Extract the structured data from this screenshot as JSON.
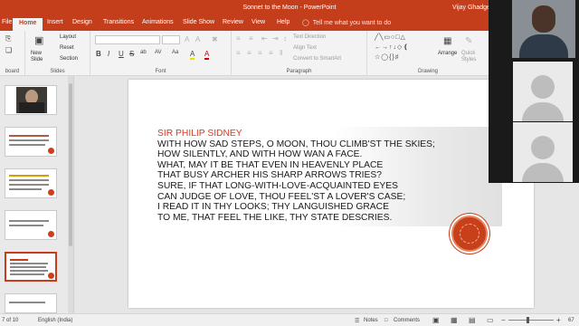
{
  "window": {
    "doc_title": "Sonnet to the Moon  -  PowerPoint",
    "user_name": "Vijay Ghadge"
  },
  "tabs": [
    {
      "label": "File"
    },
    {
      "label": "Home"
    },
    {
      "label": "Insert"
    },
    {
      "label": "Design"
    },
    {
      "label": "Transitions"
    },
    {
      "label": "Animations"
    },
    {
      "label": "Slide Show"
    },
    {
      "label": "Review"
    },
    {
      "label": "View"
    },
    {
      "label": "Help"
    }
  ],
  "tell_me": "Tell me what you want to do",
  "ribbon": {
    "groups": {
      "clipboard": "board",
      "slides": "Slides",
      "font": "Font",
      "paragraph": "Paragraph",
      "drawing": "Drawing"
    },
    "slides": {
      "new_slide": "New Slide",
      "layout": "Layout",
      "reset": "Reset",
      "section": "Section"
    },
    "font_buttons": [
      "B",
      "I",
      "U",
      "S",
      "ab",
      "AV",
      "Aa",
      "A",
      "A"
    ],
    "paragraph": {
      "text_direction": "Text Direction",
      "align_text": "Align Text",
      "convert_smartart": "Convert to SmartArt"
    },
    "drawing": {
      "arrange": "Arrange",
      "quick_styles": "Quick Styles"
    }
  },
  "slide": {
    "author": "SIR PHILIP SIDNEY",
    "lines": [
      "WITH HOW SAD STEPS, O MOON, THOU CLIMB'ST THE SKIES;",
      "HOW SILENTLY, AND WITH HOW WAN A FACE.",
      "WHAT, MAY IT BE THAT EVEN IN HEAVENLY PLACE",
      "THAT BUSY ARCHER HIS SHARP ARROWS TRIES?",
      "SURE, IF THAT LONG-WITH-LOVE-ACQUAINTED EYES",
      "CAN JUDGE OF LOVE, THOU FEEL'ST A LOVER'S CASE;",
      "I READ IT IN THY LOOKS; THY LANGUISHED GRACE",
      "TO ME, THAT FEEL THE LIKE, THY STATE DESCRIES."
    ]
  },
  "statusbar": {
    "slide_counter": "7 of 10",
    "language": "English (India)",
    "notes": "Notes",
    "comments": "Comments",
    "zoom": "67"
  },
  "icons": {
    "notes": "notes-icon",
    "comments": "comments-icon",
    "normal_view": "normal-view-icon",
    "sorter": "slide-sorter-icon",
    "reading": "reading-view-icon",
    "slideshow": "slideshow-icon"
  }
}
